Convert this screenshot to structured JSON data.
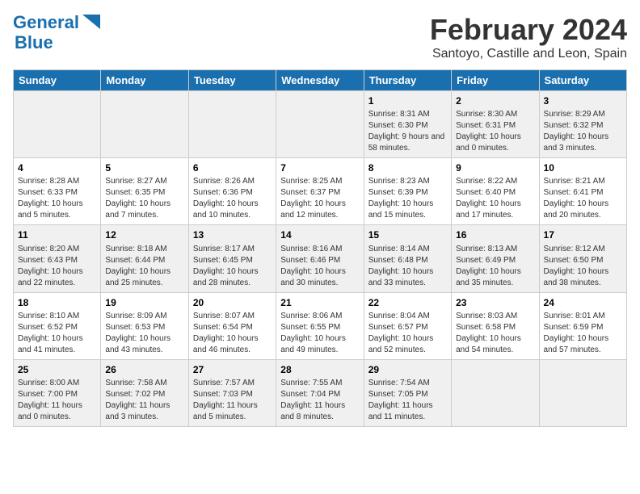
{
  "header": {
    "logo_line1": "General",
    "logo_line2": "Blue",
    "month": "February 2024",
    "location": "Santoyo, Castille and Leon, Spain"
  },
  "weekdays": [
    "Sunday",
    "Monday",
    "Tuesday",
    "Wednesday",
    "Thursday",
    "Friday",
    "Saturday"
  ],
  "weeks": [
    [
      {
        "day": "",
        "info": ""
      },
      {
        "day": "",
        "info": ""
      },
      {
        "day": "",
        "info": ""
      },
      {
        "day": "",
        "info": ""
      },
      {
        "day": "1",
        "info": "Sunrise: 8:31 AM\nSunset: 6:30 PM\nDaylight: 9 hours and 58 minutes."
      },
      {
        "day": "2",
        "info": "Sunrise: 8:30 AM\nSunset: 6:31 PM\nDaylight: 10 hours and 0 minutes."
      },
      {
        "day": "3",
        "info": "Sunrise: 8:29 AM\nSunset: 6:32 PM\nDaylight: 10 hours and 3 minutes."
      }
    ],
    [
      {
        "day": "4",
        "info": "Sunrise: 8:28 AM\nSunset: 6:33 PM\nDaylight: 10 hours and 5 minutes."
      },
      {
        "day": "5",
        "info": "Sunrise: 8:27 AM\nSunset: 6:35 PM\nDaylight: 10 hours and 7 minutes."
      },
      {
        "day": "6",
        "info": "Sunrise: 8:26 AM\nSunset: 6:36 PM\nDaylight: 10 hours and 10 minutes."
      },
      {
        "day": "7",
        "info": "Sunrise: 8:25 AM\nSunset: 6:37 PM\nDaylight: 10 hours and 12 minutes."
      },
      {
        "day": "8",
        "info": "Sunrise: 8:23 AM\nSunset: 6:39 PM\nDaylight: 10 hours and 15 minutes."
      },
      {
        "day": "9",
        "info": "Sunrise: 8:22 AM\nSunset: 6:40 PM\nDaylight: 10 hours and 17 minutes."
      },
      {
        "day": "10",
        "info": "Sunrise: 8:21 AM\nSunset: 6:41 PM\nDaylight: 10 hours and 20 minutes."
      }
    ],
    [
      {
        "day": "11",
        "info": "Sunrise: 8:20 AM\nSunset: 6:43 PM\nDaylight: 10 hours and 22 minutes."
      },
      {
        "day": "12",
        "info": "Sunrise: 8:18 AM\nSunset: 6:44 PM\nDaylight: 10 hours and 25 minutes."
      },
      {
        "day": "13",
        "info": "Sunrise: 8:17 AM\nSunset: 6:45 PM\nDaylight: 10 hours and 28 minutes."
      },
      {
        "day": "14",
        "info": "Sunrise: 8:16 AM\nSunset: 6:46 PM\nDaylight: 10 hours and 30 minutes."
      },
      {
        "day": "15",
        "info": "Sunrise: 8:14 AM\nSunset: 6:48 PM\nDaylight: 10 hours and 33 minutes."
      },
      {
        "day": "16",
        "info": "Sunrise: 8:13 AM\nSunset: 6:49 PM\nDaylight: 10 hours and 35 minutes."
      },
      {
        "day": "17",
        "info": "Sunrise: 8:12 AM\nSunset: 6:50 PM\nDaylight: 10 hours and 38 minutes."
      }
    ],
    [
      {
        "day": "18",
        "info": "Sunrise: 8:10 AM\nSunset: 6:52 PM\nDaylight: 10 hours and 41 minutes."
      },
      {
        "day": "19",
        "info": "Sunrise: 8:09 AM\nSunset: 6:53 PM\nDaylight: 10 hours and 43 minutes."
      },
      {
        "day": "20",
        "info": "Sunrise: 8:07 AM\nSunset: 6:54 PM\nDaylight: 10 hours and 46 minutes."
      },
      {
        "day": "21",
        "info": "Sunrise: 8:06 AM\nSunset: 6:55 PM\nDaylight: 10 hours and 49 minutes."
      },
      {
        "day": "22",
        "info": "Sunrise: 8:04 AM\nSunset: 6:57 PM\nDaylight: 10 hours and 52 minutes."
      },
      {
        "day": "23",
        "info": "Sunrise: 8:03 AM\nSunset: 6:58 PM\nDaylight: 10 hours and 54 minutes."
      },
      {
        "day": "24",
        "info": "Sunrise: 8:01 AM\nSunset: 6:59 PM\nDaylight: 10 hours and 57 minutes."
      }
    ],
    [
      {
        "day": "25",
        "info": "Sunrise: 8:00 AM\nSunset: 7:00 PM\nDaylight: 11 hours and 0 minutes."
      },
      {
        "day": "26",
        "info": "Sunrise: 7:58 AM\nSunset: 7:02 PM\nDaylight: 11 hours and 3 minutes."
      },
      {
        "day": "27",
        "info": "Sunrise: 7:57 AM\nSunset: 7:03 PM\nDaylight: 11 hours and 5 minutes."
      },
      {
        "day": "28",
        "info": "Sunrise: 7:55 AM\nSunset: 7:04 PM\nDaylight: 11 hours and 8 minutes."
      },
      {
        "day": "29",
        "info": "Sunrise: 7:54 AM\nSunset: 7:05 PM\nDaylight: 11 hours and 11 minutes."
      },
      {
        "day": "",
        "info": ""
      },
      {
        "day": "",
        "info": ""
      }
    ]
  ]
}
